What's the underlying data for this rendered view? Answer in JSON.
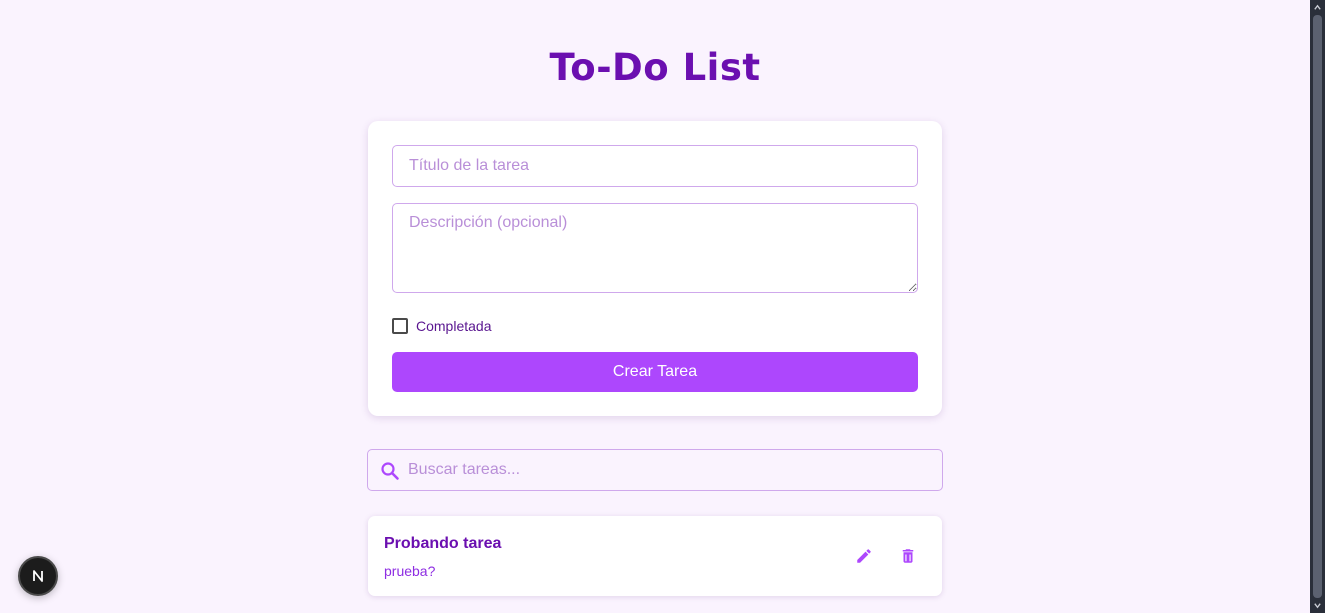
{
  "header": {
    "title": "To-Do List"
  },
  "form": {
    "title_placeholder": "Título de la tarea",
    "title_value": "",
    "description_placeholder": "Descripción (opcional)",
    "description_value": "",
    "completed_label": "Completada",
    "completed_checked": false,
    "create_label": "Crear Tarea"
  },
  "search": {
    "placeholder": "Buscar tareas...",
    "value": "",
    "icon": "search-icon"
  },
  "tasks": [
    {
      "title": "Probando tarea",
      "description": "prueba?",
      "edit_icon": "pencil-icon",
      "delete_icon": "trash-icon"
    }
  ],
  "badge": {
    "letter": "N",
    "icon": "nextjs-logo-icon"
  },
  "colors": {
    "background": "#faf3fe",
    "primary": "#ad47fd",
    "title": "#6b0fb0",
    "border": "#cfa8ec"
  }
}
